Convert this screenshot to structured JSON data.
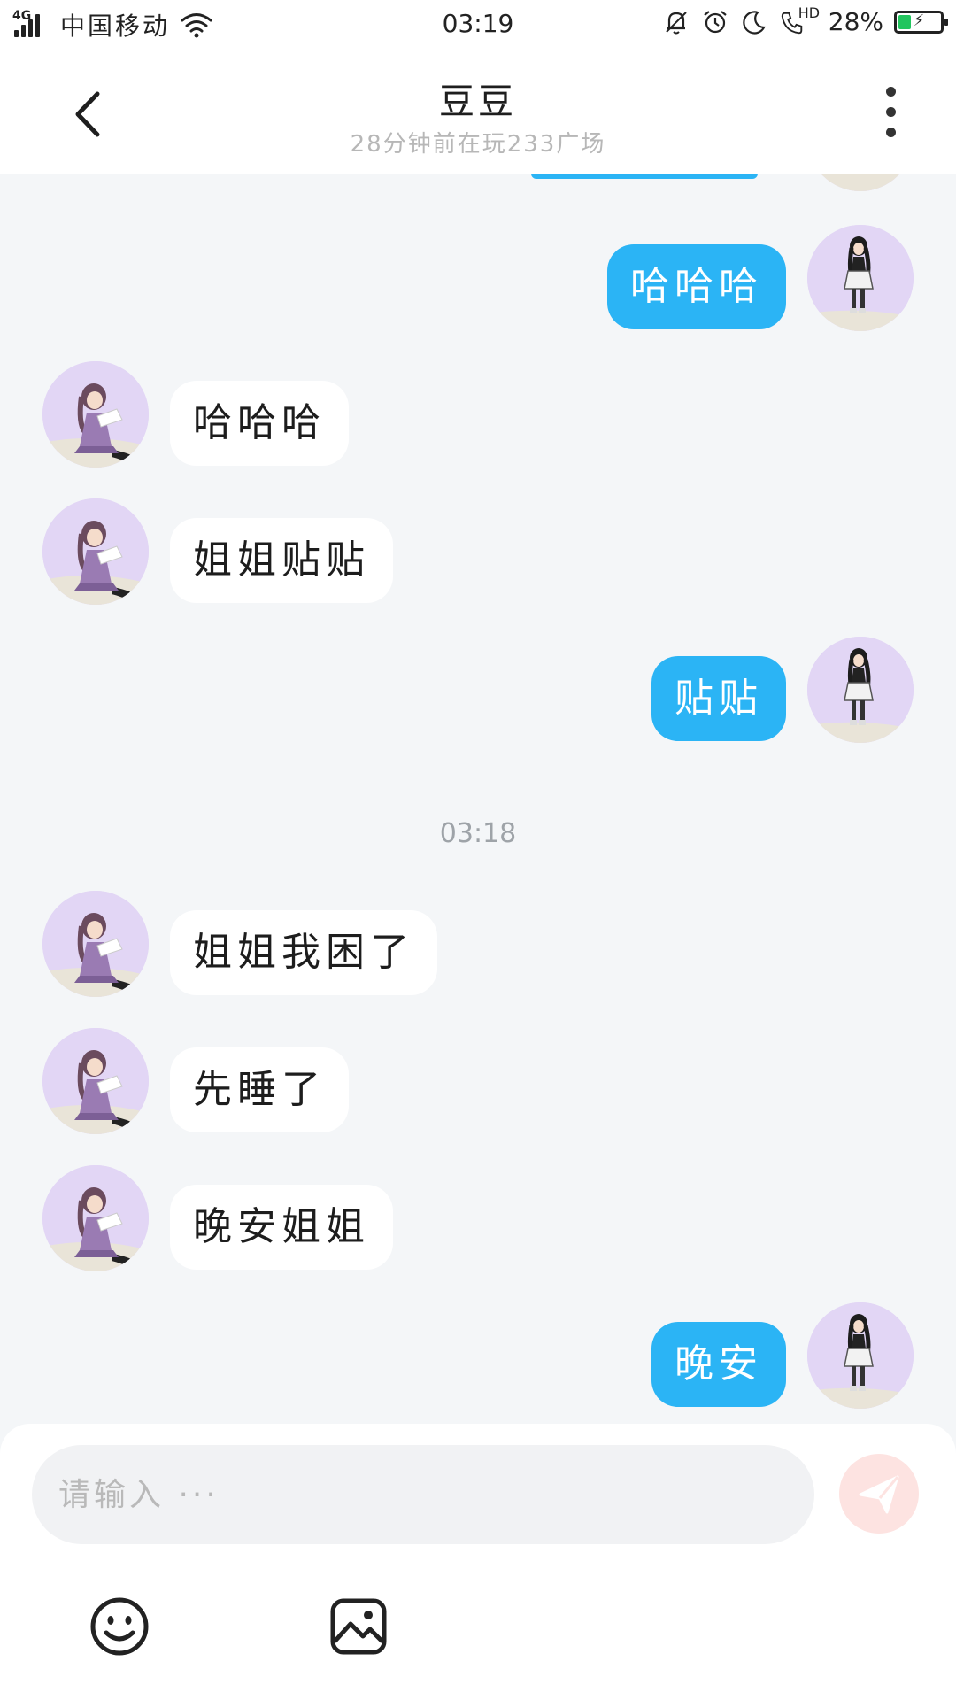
{
  "status_bar": {
    "network": "4G",
    "carrier": "中国移动",
    "time": "03:19",
    "battery": "28%",
    "hd": "HD"
  },
  "header": {
    "title": "豆豆",
    "subtitle": "28分钟前在玩233广场"
  },
  "colors": {
    "outgoing_bubble": "#2bb4f5",
    "incoming_bubble": "#ffffff",
    "background": "#f4f6f8",
    "avatar_bg": "#e2d6f5",
    "send_button": "#fde3e1"
  },
  "messages": [
    {
      "from": "me",
      "text": "哈哈哈"
    },
    {
      "from": "them",
      "text": "哈哈哈"
    },
    {
      "from": "them",
      "text": "姐姐贴贴"
    },
    {
      "from": "me",
      "text": "贴贴"
    },
    {
      "type": "time",
      "text": "03:18"
    },
    {
      "from": "them",
      "text": "姐姐我困了"
    },
    {
      "from": "them",
      "text": "先睡了"
    },
    {
      "from": "them",
      "text": "晚安姐姐"
    },
    {
      "from": "me",
      "text": "晚安"
    }
  ],
  "composer": {
    "placeholder": "请输入 ···",
    "value": ""
  },
  "icons": {
    "back": "chevron-left-icon",
    "more": "more-vertical-icon",
    "send": "send-icon",
    "emoji": "emoji-icon",
    "image": "image-icon"
  }
}
